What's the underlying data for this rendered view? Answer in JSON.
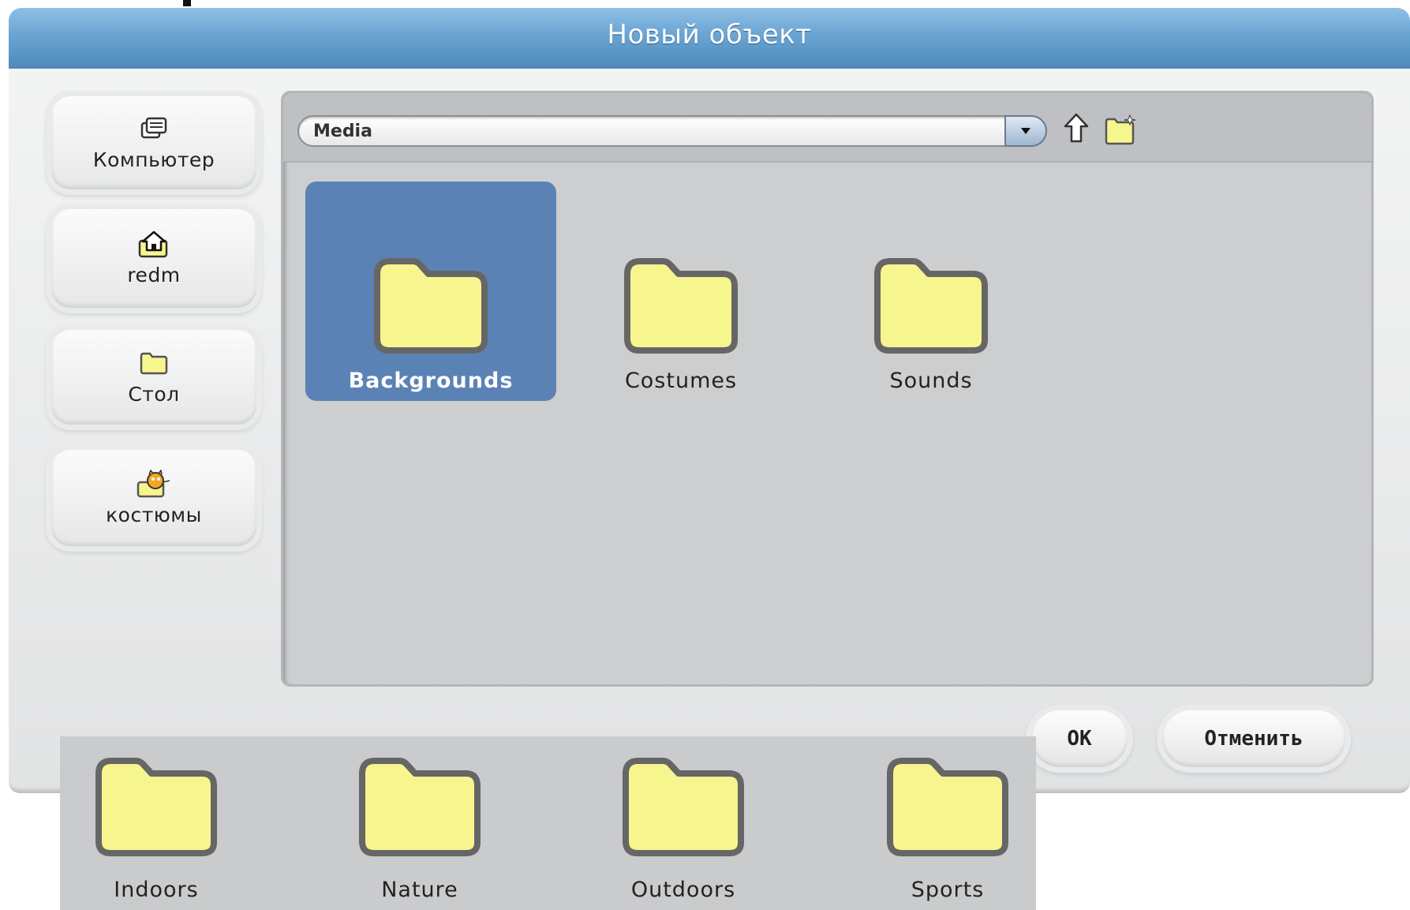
{
  "dialog": {
    "title": "Новый объект",
    "title_color": "#5f99c9"
  },
  "sidebar": {
    "items": [
      {
        "label": "Компьютер",
        "icon": "computer-icon"
      },
      {
        "label": "redm",
        "icon": "home-icon"
      },
      {
        "label": "Стол",
        "icon": "folder-icon"
      },
      {
        "label": "костюмы",
        "icon": "costumes-icon"
      }
    ]
  },
  "browser": {
    "path": "Media",
    "up_icon": "up-arrow-icon",
    "new_folder_icon": "new-folder-icon",
    "items": [
      {
        "name": "Backgrounds",
        "selected": true
      },
      {
        "name": "Costumes",
        "selected": false
      },
      {
        "name": "Sounds",
        "selected": false
      }
    ],
    "selection_color": "#5b82b5",
    "folder_color": "#f7f58e"
  },
  "buttons": {
    "ok": "ОК",
    "cancel": "Отменить"
  },
  "subfolders": {
    "items": [
      "Indoors",
      "Nature",
      "Outdoors",
      "Sports"
    ]
  }
}
